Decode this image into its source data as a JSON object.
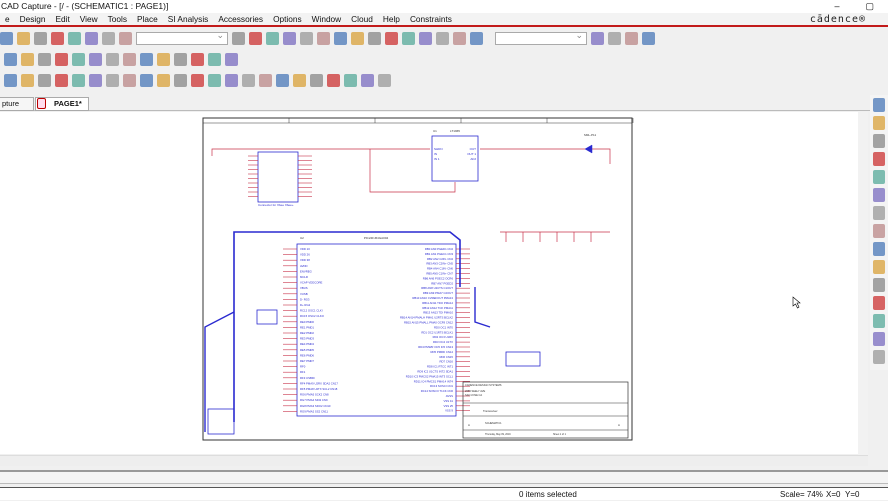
{
  "window": {
    "title": "CAD Capture - [/ - (SCHEMATIC1 : PAGE1)]",
    "minimize": "–",
    "maximize": "▢",
    "brand": "cādence®"
  },
  "menu": [
    "e",
    "Design",
    "Edit",
    "View",
    "Tools",
    "Place",
    "SI Analysis",
    "Accessories",
    "Options",
    "Window",
    "Cloud",
    "Help",
    "Constraints"
  ],
  "toolbar1": {
    "left": [
      "open-folder",
      "save",
      "print",
      "cut",
      "copy",
      "paste",
      "undo",
      "redo"
    ],
    "right": [
      "zoom-in",
      "zoom-out",
      "zoom-area",
      "zoom-all",
      "eye",
      "netlist",
      "annotate",
      "drc",
      "bom",
      "cross-ref",
      "report",
      "layout",
      "back-annotate",
      "hierarchy",
      "help"
    ],
    "search_value": "",
    "find_value": ""
  },
  "toolbar2": [
    "select",
    "snap-grid",
    "play",
    "area-select",
    "wire-a",
    "wire-b",
    "wire-c",
    "wire-d",
    "circle-v",
    "part-v",
    "circle-a",
    "part-b",
    "circle-w",
    "part-c"
  ],
  "toolbar3": [
    "place-part",
    "net-alias",
    "bus",
    "wire-entry",
    "no-connect",
    "search-part",
    "place-hier",
    "power",
    "off-page",
    "title-block",
    "text",
    "edit",
    "copy-prop",
    "table",
    "align-left",
    "align-center",
    "align-right",
    "align-top",
    "align-middle",
    "align-bottom",
    "distribute",
    "align-grid",
    "tag"
  ],
  "tabs": [
    {
      "label": "pture tu...*"
    },
    {
      "label": "PAGE1*"
    }
  ],
  "palette": [
    "select",
    "wire",
    "net-group",
    "bus",
    "auto-wire",
    "no-connect",
    "ground",
    "part",
    "hier-block",
    "net-alias",
    "off-page",
    "bus-entry",
    "junction",
    "text",
    "diamond"
  ],
  "schematic": {
    "u1": {
      "ref": "U1",
      "name": "LT1965",
      "left_pins": [
        "SHDN",
        "IN",
        "IN 1"
      ],
      "right_pins": [
        "OUT",
        "OUT 1",
        "ADJ"
      ]
    },
    "led": "SML-P11",
    "conn": "Connector for Xbee Xbee+",
    "mcu": {
      "ref": "U2",
      "name": "PIC24FJ64GA004",
      "left_pins": [
        "VDD 10",
        "VDD 26",
        "VDD 38",
        "AVDD",
        "ENVREG",
        "MCLR",
        "VCAP VDDCORE",
        "VBUS",
        "VUSB",
        "D- RG3",
        "D+ RG2",
        "RC12 OSC1 CLKI",
        "RC15 OSC2 CLKO",
        "RE0 PMD0",
        "RE1 PMD1",
        "RE2 PMD2",
        "RE3 PMD3",
        "RE4 PMD4",
        "RE5 PMD5",
        "RE6 PMD6",
        "RE7 PMD7",
        "RF0",
        "RF1",
        "RF3 USBID",
        "RF4 PMA9 U2RX SDA2 CN17",
        "RF5 PMA8 U2TX SCL2 CN18",
        "RG6 PMA5 SCK2 CN8",
        "RG7 PMA4 SDI2 CN9",
        "RG8 PMA3 SDO2 CN10",
        "RG9 PMA2 SS2 CN11"
      ],
      "right_pins": [
        "RB0 AN0 PGED1 CN2",
        "RB1 AN1 PGEC1 CN3",
        "RB2 AN2 C2IN- CN4",
        "RB3 AN3 C2IN+ CN5",
        "RB4 AN4 C1IN- CN6",
        "RB5 AN5 C1IN+ CN7",
        "RB6 AN6 PGEC2 OCR6",
        "RB7 AN7 PGED2",
        "RB8 AN8 U2CTS C1OUT",
        "RB9 AN9 PMA7 C2OUT",
        "RB10 AN10 CVREFOUT PMA13",
        "RB11 AN11 TDO PMA12",
        "RB12 AN12 TCK PMA11",
        "RB13 AN13 TDI PMA10",
        "RB14 AN14 PMALH PMA1 U2RTS BCLK2",
        "RB15 AN15 PMALL PMA0 OCF8 CN12",
        "RD0 OC1 INT0",
        "RD1 OC2 U1RTS BCLK1",
        "RD2 OC3 U1RX",
        "RD3 OC4 U1TX",
        "RD4 PMWR OC5 IC5 CN13",
        "RD5 PMRD CN14",
        "RD6 CN15",
        "RD7 CN16",
        "RD8 IC1 RTCC INT1",
        "RD9 IC2 U1CTS INT2 SDA1",
        "RD10 IC3 PMCS2 PMA15 INT3 SCL1",
        "RD11 IC4 PMCS1 PMA14 INT4",
        "RC13 SOSCI CN1",
        "RC14 SOSCO T1CK CN0",
        "AVSS",
        "VSS 41",
        "VSS 25",
        "VSS 9"
      ]
    },
    "title_block": {
      "company": "CADENCE DESIGN SYSTEMS",
      "address": "2655 SEELY AVE",
      "city": "SAN JOSE CA",
      "title": "Transceiver",
      "size": "A",
      "doc": "SCHEMATIC1",
      "rev": "A",
      "date": "Thursday, May 09, 2019",
      "sheet": "Sheet 1 of 1"
    }
  },
  "status": {
    "selection": "0 items selected",
    "scale": "Scale= 74%",
    "x": "X=0",
    "y": "Y=0"
  }
}
